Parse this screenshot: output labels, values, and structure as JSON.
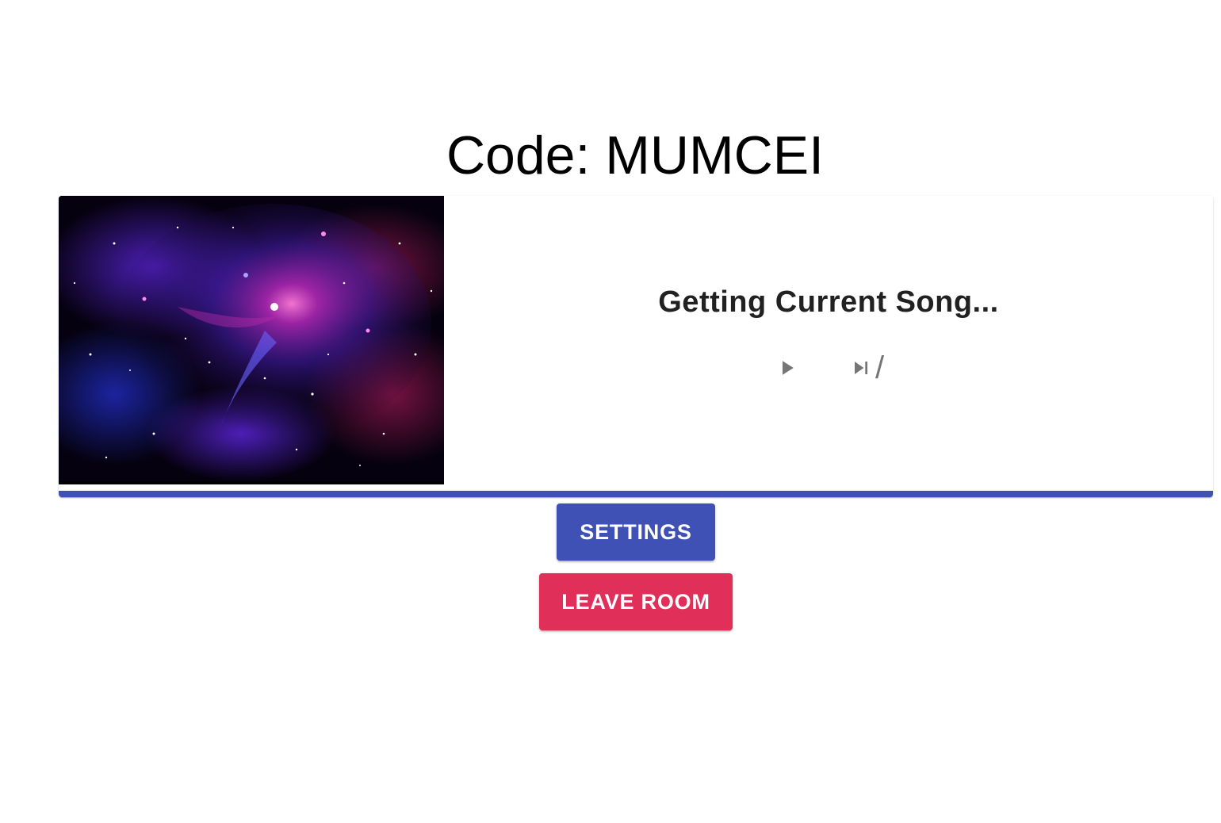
{
  "room": {
    "code_text": "Code: MUMCEI"
  },
  "player": {
    "song_title": "Getting Current Song...",
    "vote_text": "/",
    "progress_percent": 100,
    "album_art": "galaxy-nebula-image",
    "icons": {
      "play": "play-icon",
      "skip": "skip-next-icon"
    }
  },
  "buttons": {
    "settings_label": "Settings",
    "leave_label": "Leave Room"
  },
  "colors": {
    "primary": "#3f51b5",
    "secondary": "#e0305a",
    "icon": "#757575"
  }
}
